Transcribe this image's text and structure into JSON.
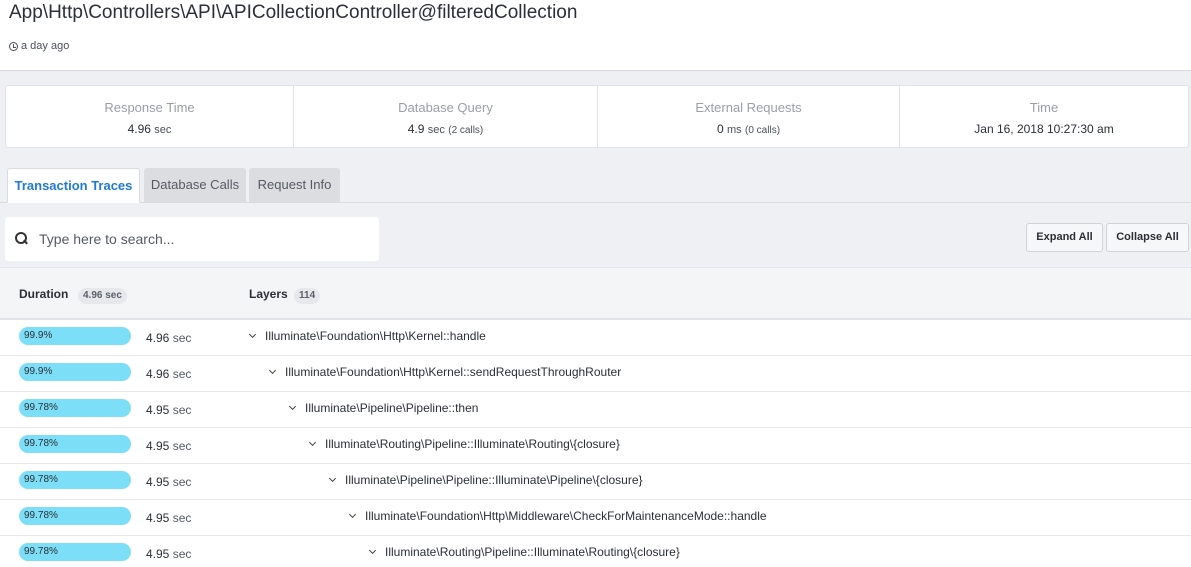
{
  "header": {
    "title": "App\\Http\\Controllers\\API\\APICollectionController@filteredCollection",
    "time_ago": "a day ago"
  },
  "stats": [
    {
      "label": "Response Time",
      "value": "4.96",
      "unit": "sec",
      "calls": ""
    },
    {
      "label": "Database Query",
      "value": "4.9",
      "unit": "sec",
      "calls": "(2 calls)"
    },
    {
      "label": "External Requests",
      "value": "0",
      "unit": "ms",
      "calls": "(0 calls)"
    },
    {
      "label": "Time",
      "value": "Jan 16, 2018 10:27:30 am",
      "unit": "",
      "calls": ""
    }
  ],
  "tabs": [
    {
      "label": "Transaction Traces",
      "active": true
    },
    {
      "label": "Database Calls",
      "active": false
    },
    {
      "label": "Request Info",
      "active": false
    }
  ],
  "search": {
    "placeholder": "Type here to search..."
  },
  "buttons": {
    "expand": "Expand All",
    "collapse": "Collapse All"
  },
  "table": {
    "duration_header": "Duration",
    "duration_badge": "4.96 sec",
    "layers_header": "Layers",
    "layers_badge": "114",
    "rows": [
      {
        "percent": "99.9%",
        "duration": "4.96",
        "unit": "sec",
        "depth": 0,
        "layer": "Illuminate\\Foundation\\Http\\Kernel::handle"
      },
      {
        "percent": "99.9%",
        "duration": "4.96",
        "unit": "sec",
        "depth": 1,
        "layer": "Illuminate\\Foundation\\Http\\Kernel::sendRequestThroughRouter"
      },
      {
        "percent": "99.78%",
        "duration": "4.95",
        "unit": "sec",
        "depth": 2,
        "layer": "Illuminate\\Pipeline\\Pipeline::then"
      },
      {
        "percent": "99.78%",
        "duration": "4.95",
        "unit": "sec",
        "depth": 3,
        "layer": "Illuminate\\Routing\\Pipeline::Illuminate\\Routing\\{closure}"
      },
      {
        "percent": "99.78%",
        "duration": "4.95",
        "unit": "sec",
        "depth": 4,
        "layer": "Illuminate\\Pipeline\\Pipeline::Illuminate\\Pipeline\\{closure}"
      },
      {
        "percent": "99.78%",
        "duration": "4.95",
        "unit": "sec",
        "depth": 5,
        "layer": "Illuminate\\Foundation\\Http\\Middleware\\CheckForMaintenanceMode::handle"
      },
      {
        "percent": "99.78%",
        "duration": "4.95",
        "unit": "sec",
        "depth": 6,
        "layer": "Illuminate\\Routing\\Pipeline::Illuminate\\Routing\\{closure}"
      }
    ]
  }
}
